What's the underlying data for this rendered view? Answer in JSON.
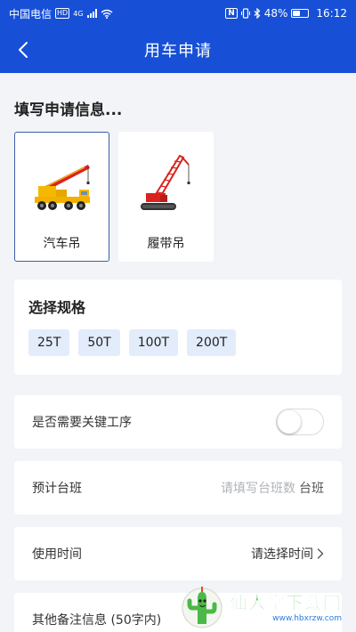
{
  "status_bar": {
    "carrier": "中国电信",
    "hd": "HD",
    "network": "4G",
    "nfc": "N",
    "battery": "48%",
    "battery_level": 0.48,
    "time": "16:12"
  },
  "header": {
    "title": "用车申请"
  },
  "form": {
    "section_title": "填写申请信息...",
    "vehicles": [
      {
        "label": "汽车吊",
        "icon": "truck-crane-icon",
        "selected": true
      },
      {
        "label": "履带吊",
        "icon": "crawler-crane-icon",
        "selected": false
      }
    ],
    "spec": {
      "title": "选择规格",
      "options": [
        "25T",
        "50T",
        "100T",
        "200T"
      ]
    },
    "key_process": {
      "label": "是否需要关键工序",
      "enabled": false
    },
    "shifts": {
      "label": "预计台班",
      "placeholder": "请填写台班数",
      "unit": "台班"
    },
    "use_time": {
      "label": "使用时间",
      "value": "请选择时间"
    },
    "remarks": {
      "label": "其他备注信息 (50字内)"
    }
  },
  "watermark": {
    "text": "仙人掌下载网",
    "url": "www.hbxrzw.com"
  },
  "colors": {
    "primary": "#1750d6",
    "chip_bg": "#e3ecfb",
    "selected_border": "#3a5ea8"
  }
}
